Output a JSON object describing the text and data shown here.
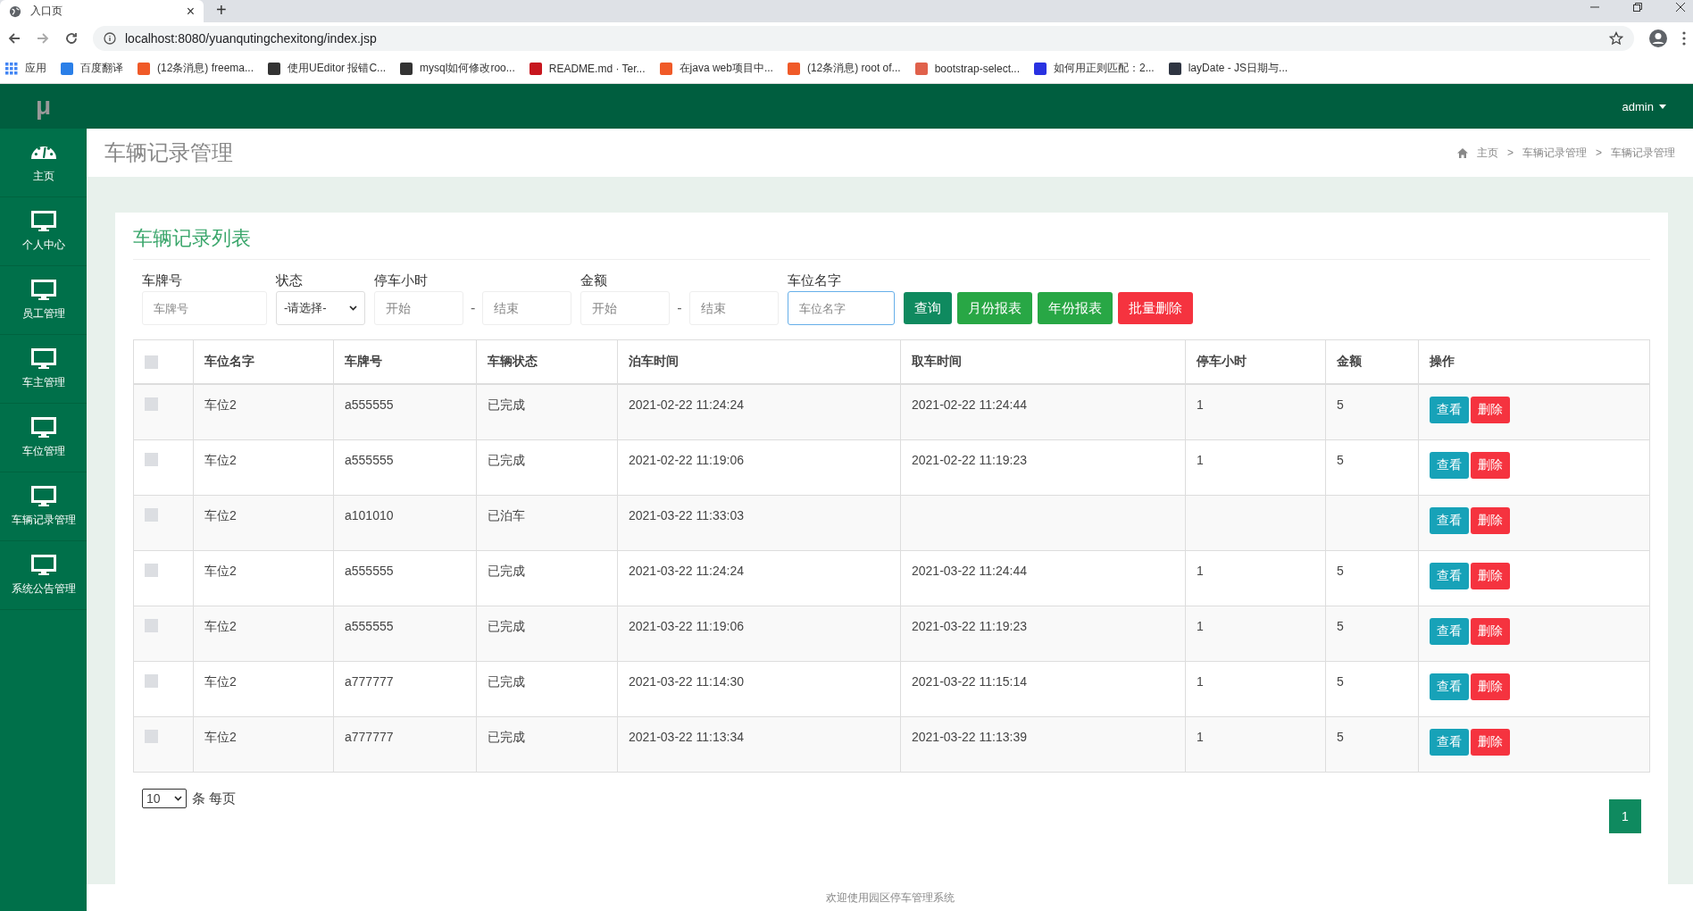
{
  "browser": {
    "tab": {
      "title": "入口页",
      "close": "×"
    },
    "new_tab": "+",
    "url": "localhost:8080/yuanqutingchexitong/index.jsp",
    "bookmarks": [
      {
        "label": "应用",
        "color": "#4285f4"
      },
      {
        "label": "百度翻译",
        "color": "#2a7fe8"
      },
      {
        "label": "(12条消息) freema...",
        "color": "#f05a28"
      },
      {
        "label": "使用UEditor 报错C...",
        "color": "#333333"
      },
      {
        "label": "mysql如何修改roo...",
        "color": "#333333"
      },
      {
        "label": "README.md · Ter...",
        "color": "#c7161e"
      },
      {
        "label": "在java web项目中...",
        "color": "#f05a28"
      },
      {
        "label": "(12条消息) root of...",
        "color": "#f05a28"
      },
      {
        "label": "bootstrap-select...",
        "color": "#e0614b"
      },
      {
        "label": "如何用正则匹配：2...",
        "color": "#2932e1"
      },
      {
        "label": "layDate - JS日期与...",
        "color": "#2f3542"
      }
    ]
  },
  "app": {
    "logo": "μ",
    "user": "admin"
  },
  "sidebar": {
    "items": [
      {
        "label": "主页",
        "kind": "gauge"
      },
      {
        "label": "个人中心",
        "kind": "monitor"
      },
      {
        "label": "员工管理",
        "kind": "monitor"
      },
      {
        "label": "车主管理",
        "kind": "monitor"
      },
      {
        "label": "车位管理",
        "kind": "monitor"
      },
      {
        "label": "车辆记录管理",
        "kind": "monitor"
      },
      {
        "label": "系统公告管理",
        "kind": "monitor"
      }
    ]
  },
  "page_header": {
    "title": "车辆记录管理",
    "breadcrumb": [
      "主页",
      "车辆记录管理",
      "车辆记录管理"
    ],
    "separator": ">"
  },
  "card": {
    "title": "车辆记录列表",
    "filters": {
      "plate": {
        "label": "车牌号",
        "placeholder": "车牌号"
      },
      "status": {
        "label": "状态",
        "value": "-请选择-"
      },
      "hours": {
        "label": "停车小时",
        "from": {
          "placeholder": "开始"
        },
        "to": {
          "placeholder": "结束"
        }
      },
      "amount": {
        "label": "金额",
        "from": {
          "placeholder": "开始"
        },
        "to": {
          "placeholder": "结束"
        }
      },
      "dash": "-",
      "space": {
        "label": "车位名字",
        "placeholder": "车位名字"
      }
    },
    "buttons": [
      {
        "label": "查询",
        "kind": "search"
      },
      {
        "label": "月份报表",
        "kind": "report"
      },
      {
        "label": "年份报表",
        "kind": "report"
      },
      {
        "label": "批量删除",
        "kind": "danger"
      }
    ],
    "table": {
      "header_checked": false,
      "columns": [
        "车位名字",
        "车牌号",
        "车辆状态",
        "泊车时间",
        "取车时间",
        "停车小时",
        "金额",
        "操作"
      ],
      "rows": [
        {
          "checked": false,
          "cells": [
            "车位2",
            "a555555",
            "已完成",
            "2021-02-22 11:24:24",
            "2021-02-22 11:24:44",
            "1",
            "5"
          ],
          "actions": [
            "查看",
            "删除"
          ]
        },
        {
          "checked": false,
          "cells": [
            "车位2",
            "a555555",
            "已完成",
            "2021-02-22 11:19:06",
            "2021-02-22 11:19:23",
            "1",
            "5"
          ],
          "actions": [
            "查看",
            "删除"
          ]
        },
        {
          "checked": false,
          "cells": [
            "车位2",
            "a101010",
            "已泊车",
            "2021-03-22 11:33:03",
            "",
            "",
            ""
          ],
          "actions": [
            "查看",
            "删除"
          ]
        },
        {
          "checked": false,
          "cells": [
            "车位2",
            "a555555",
            "已完成",
            "2021-03-22 11:24:24",
            "2021-03-22 11:24:44",
            "1",
            "5"
          ],
          "actions": [
            "查看",
            "删除"
          ]
        },
        {
          "checked": false,
          "cells": [
            "车位2",
            "a555555",
            "已完成",
            "2021-03-22 11:19:06",
            "2021-03-22 11:19:23",
            "1",
            "5"
          ],
          "actions": [
            "查看",
            "删除"
          ]
        },
        {
          "checked": false,
          "cells": [
            "车位2",
            "a777777",
            "已完成",
            "2021-03-22 11:14:30",
            "2021-03-22 11:15:14",
            "1",
            "5"
          ],
          "actions": [
            "查看",
            "删除"
          ]
        },
        {
          "checked": false,
          "cells": [
            "车位2",
            "a777777",
            "已完成",
            "2021-03-22 11:13:34",
            "2021-03-22 11:13:39",
            "1",
            "5"
          ],
          "actions": [
            "查看",
            "删除"
          ]
        }
      ]
    },
    "page_size": {
      "value": "10",
      "suffix": "条 每页"
    },
    "pages": [
      {
        "label": "1",
        "selected": true
      }
    ]
  },
  "footer": "欢迎使用园区停车管理系统"
}
